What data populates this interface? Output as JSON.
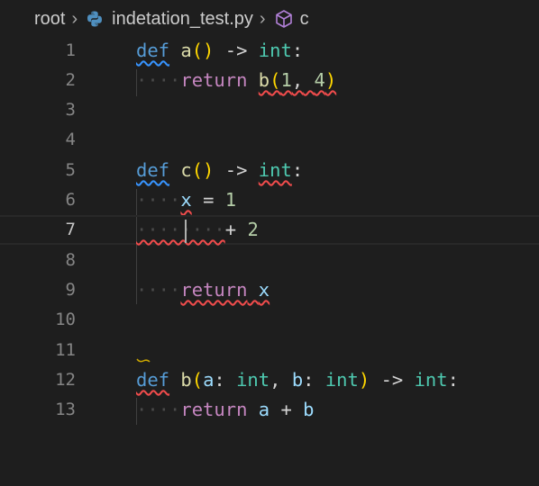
{
  "breadcrumb": {
    "root": "root",
    "file": "indetation_test.py",
    "symbol": "c"
  },
  "icons": {
    "python": "python-file-icon",
    "symbol": "symbol-class-cube-icon",
    "separator": "chevron-right-icon"
  },
  "colors": {
    "background": "#1e1e1e",
    "keyword_def": "#569cd6",
    "keyword_return": "#c586c0",
    "function": "#dcdcaa",
    "type": "#4ec9b0",
    "number": "#b5cea8",
    "variable": "#9cdcfe",
    "error_squiggle": "#f14c4c",
    "info_squiggle": "#3794ff"
  },
  "editor": {
    "current_line": 7,
    "lines": [
      {
        "n": "1"
      },
      {
        "n": "2"
      },
      {
        "n": "3"
      },
      {
        "n": "4"
      },
      {
        "n": "5"
      },
      {
        "n": "6"
      },
      {
        "n": "7"
      },
      {
        "n": "8"
      },
      {
        "n": "9"
      },
      {
        "n": "10"
      },
      {
        "n": "11"
      },
      {
        "n": "12"
      },
      {
        "n": "13"
      }
    ],
    "tokens": {
      "def": "def",
      "return": "return",
      "a": "a",
      "b": "b",
      "c": "c",
      "x": "x",
      "int": "int",
      "arrow": "->",
      "colon": ":",
      "lparen": "(",
      "rparen": ")",
      "empty_parens": "()",
      "one": "1",
      "two": "2",
      "four": "4",
      "plus": "+",
      "eq": "=",
      "comma": ",",
      "dots4": "····",
      "dots8": "········"
    }
  }
}
